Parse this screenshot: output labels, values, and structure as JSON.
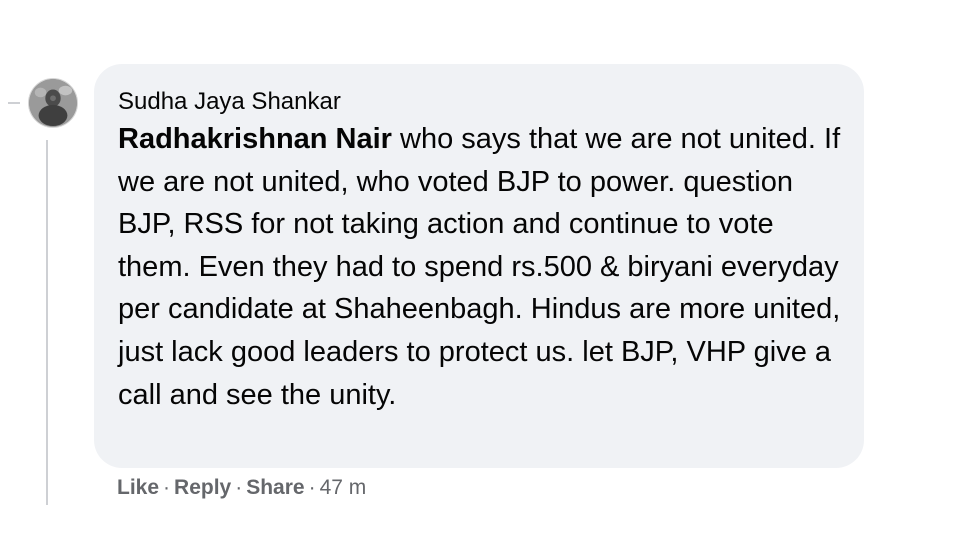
{
  "comment": {
    "author": "Sudha Jaya Shankar",
    "mention": "Radhakrishnan Nair",
    "text": " who says that we are not united. If we are not united, who voted BJP to power. question BJP, RSS for not taking action and continue to vote them. Even they had to spend rs.500 & biryani everyday per candidate at Shaheenbagh. Hindus are more united, just lack good leaders to protect us. let BJP, VHP give a call and see the unity."
  },
  "actions": {
    "like": "Like",
    "reply": "Reply",
    "share": "Share",
    "separator": "·",
    "timestamp": "47 m"
  },
  "icons": {
    "avatar": "profile-photo-icon"
  },
  "colors": {
    "bubble": "#f0f2f5",
    "text": "#050505",
    "meta": "#65676b",
    "thread_line": "#ced0d4"
  }
}
